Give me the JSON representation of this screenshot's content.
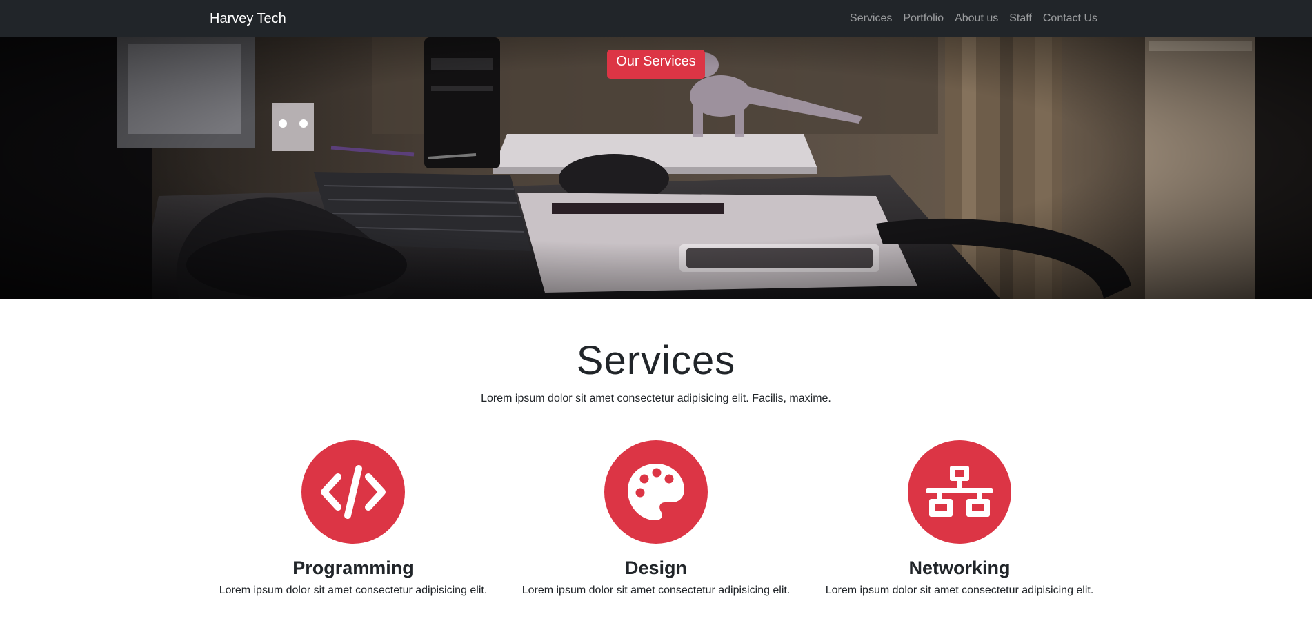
{
  "navbar": {
    "brand": "Harvey Tech",
    "links": [
      "Services",
      "Portfolio",
      "About us",
      "Staff",
      "Contact Us"
    ]
  },
  "hero": {
    "button_label": "Our Services"
  },
  "services": {
    "title": "Services",
    "lead": "Lorem ipsum dolor sit amet consectetur adipisicing elit. Facilis, maxime.",
    "items": [
      {
        "icon": "code-icon",
        "title": "Programming",
        "text": "Lorem ipsum dolor sit amet consectetur adipisicing elit."
      },
      {
        "icon": "palette-icon",
        "title": "Design",
        "text": "Lorem ipsum dolor sit amet consectetur adipisicing elit."
      },
      {
        "icon": "network-icon",
        "title": "Networking",
        "text": "Lorem ipsum dolor sit amet consectetur adipisicing elit."
      }
    ]
  },
  "colors": {
    "navbar_bg": "#212529",
    "accent": "#dc3545",
    "text": "#212529"
  }
}
